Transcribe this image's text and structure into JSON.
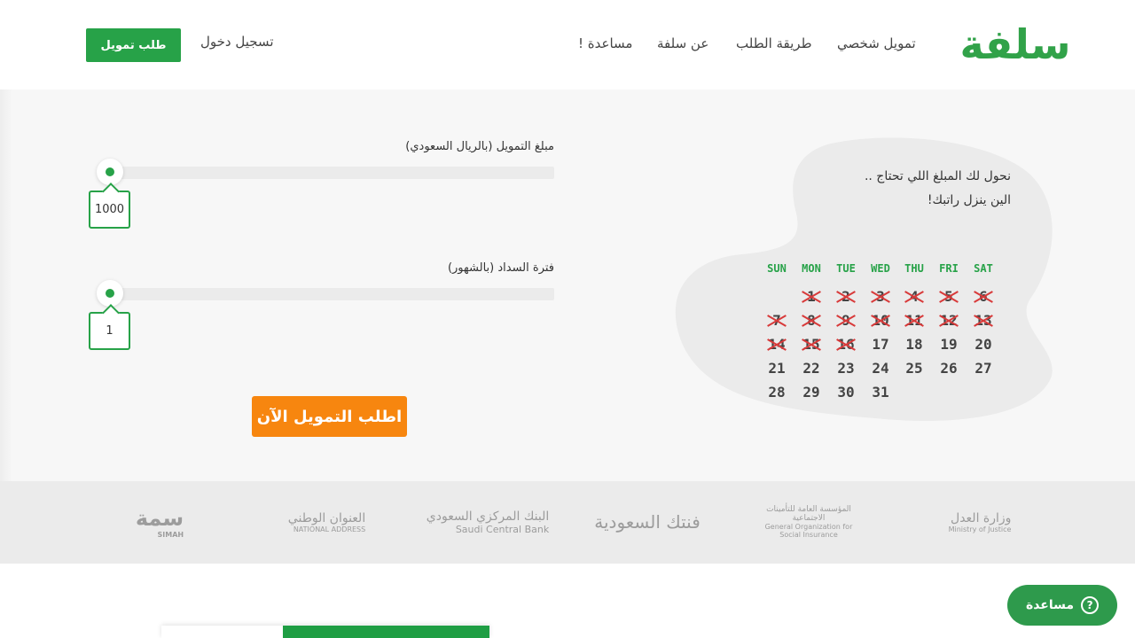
{
  "brand": {
    "logo_text": "سلفة",
    "accent": "#27a248",
    "cta_color": "#f7860f"
  },
  "nav": {
    "items": [
      "تمويل شخصي",
      "طريقة الطلب",
      "عن سلفة",
      "مساعدة !"
    ],
    "login": "تسجيل دخول",
    "apply": "طلب تمويل"
  },
  "calculator": {
    "amount_label": "مبلغ التمويل (بالريال السعودي)",
    "amount_value": "1000",
    "amount_level": 0,
    "period_label": "فترة السداد (بالشهور)",
    "period_value": "1",
    "period_level": 0,
    "cta": "اطلب التمويل الآن"
  },
  "promo": {
    "line1": "نحول لك المبلغ اللي تحتاج ..",
    "line2": "الين ينزل راتبك!",
    "weekdays": [
      "SUN",
      "MON",
      "TUE",
      "WED",
      "THU",
      "FRI",
      "SAT"
    ],
    "days": [
      "1",
      "2",
      "3",
      "4",
      "5",
      "6",
      "7",
      "8",
      "9",
      "10",
      "11",
      "12",
      "13",
      "14",
      "15",
      "16",
      "17",
      "18",
      "19",
      "20",
      "21",
      "22",
      "23",
      "24",
      "25",
      "26",
      "27",
      "28",
      "29",
      "30",
      "31"
    ],
    "crossed_through": 16
  },
  "partners": [
    {
      "name": "وزارة العدل",
      "sub": "Ministry of Justice",
      "icon": "ministry-of-justice-logo"
    },
    {
      "name": "المؤسسة العامة للتأمينات الاجتماعية",
      "sub": "General Organization for Social Insurance",
      "icon": "gosi-logo"
    },
    {
      "name": "فنتك السعودية",
      "sub": "",
      "icon": "fintech-saudi-logo"
    },
    {
      "name": "البنك المركزي السعودي",
      "sub": "Saudi Central Bank",
      "icon": "sama-logo"
    },
    {
      "name": "العنوان الوطني",
      "sub": "NATIONAL ADDRESS",
      "icon": "national-address-logo"
    },
    {
      "name": "سمة",
      "sub": "SIMAH",
      "icon": "simah-logo"
    }
  ],
  "help": {
    "label": "مساعدة",
    "icon": "question-icon"
  }
}
